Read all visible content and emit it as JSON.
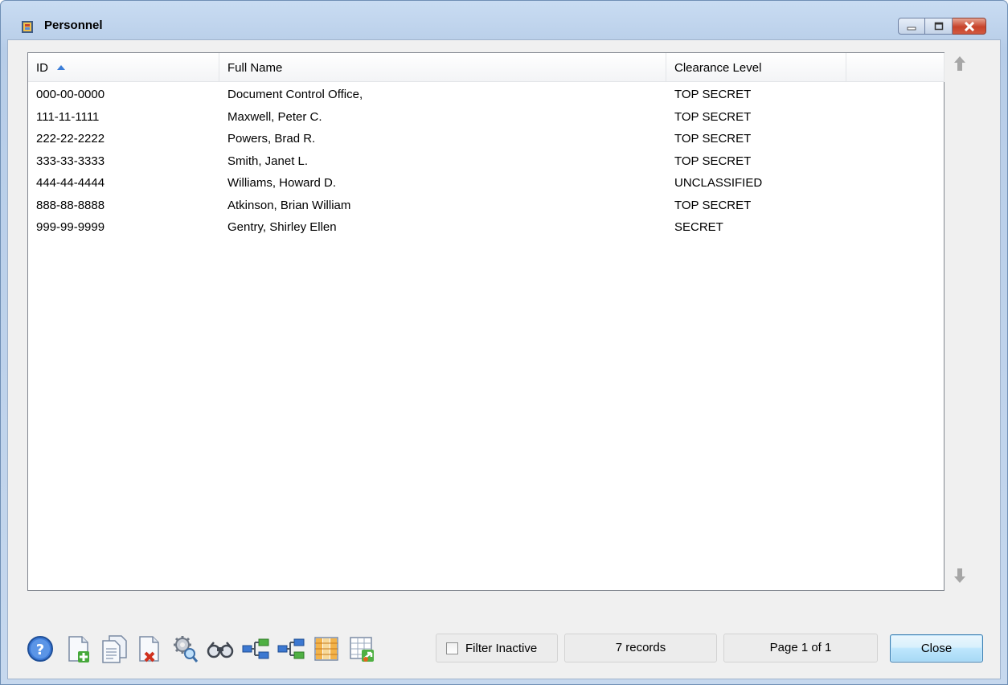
{
  "window": {
    "title": "Personnel"
  },
  "grid": {
    "columns": [
      {
        "label": "ID",
        "sorted": "ascending"
      },
      {
        "label": "Full Name"
      },
      {
        "label": "Clearance Level"
      },
      {
        "label": ""
      }
    ],
    "rows": [
      {
        "id": "000-00-0000",
        "name": "Document Control Office,",
        "clearance": "TOP SECRET"
      },
      {
        "id": "111-11-1111",
        "name": "Maxwell, Peter C.",
        "clearance": "TOP SECRET"
      },
      {
        "id": "222-22-2222",
        "name": "Powers, Brad R.",
        "clearance": "TOP SECRET"
      },
      {
        "id": "333-33-3333",
        "name": "Smith, Janet L.",
        "clearance": "TOP SECRET"
      },
      {
        "id": "444-44-4444",
        "name": "Williams, Howard D.",
        "clearance": "UNCLASSIFIED"
      },
      {
        "id": "888-88-8888",
        "name": "Atkinson, Brian William",
        "clearance": "TOP SECRET"
      },
      {
        "id": "999-99-9999",
        "name": "Gentry, Shirley Ellen",
        "clearance": "SECRET"
      }
    ]
  },
  "toolbar": {
    "icons": [
      "help-icon",
      "add-record-icon",
      "copy-record-icon",
      "delete-record-icon",
      "settings-search-icon",
      "binoculars-find-icon",
      "hierarchy-icon",
      "hierarchy-alt-icon",
      "columns-icon",
      "export-grid-icon"
    ]
  },
  "footer": {
    "filter_label": "Filter Inactive",
    "filter_checked": false,
    "record_count": "7 records",
    "page_info": "Page 1 of 1",
    "close_label": "Close"
  },
  "colors": {
    "accent": "#3c7fb1",
    "sort_arrow": "#3b7dd8"
  }
}
